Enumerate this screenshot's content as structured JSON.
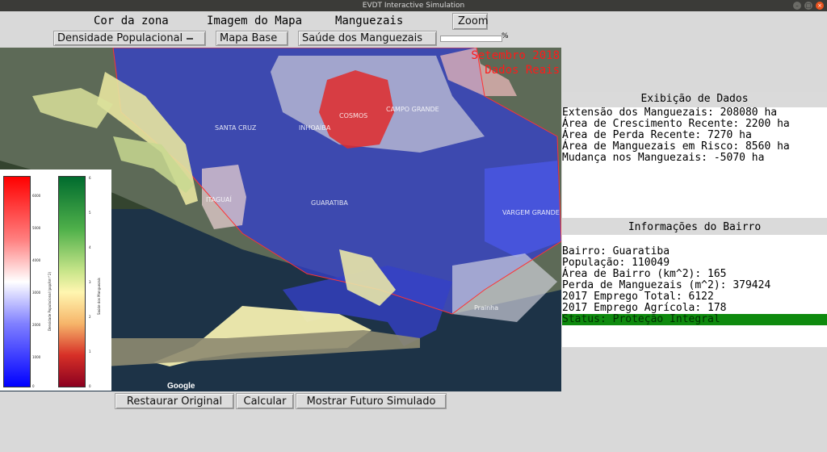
{
  "window": {
    "title": "EVDT Interactive Simulation"
  },
  "toolbar": {
    "zone_color_label": "Cor da zona",
    "map_image_label": "Imagem do Mapa",
    "mangroves_label": "Manguezais",
    "zoom_button": "Zoom",
    "zone_color_select": "Densidade Populacional",
    "map_image_select": "Mapa Base",
    "mangroves_select": "Saúde dos Manguezais",
    "slider_unit": "%"
  },
  "map": {
    "date_label": "Setembro 2018",
    "data_label": "Dados Reais",
    "google_logo": "Google",
    "places": [
      "SANTA CRUZ",
      "GUARATIBA",
      "CAMPO GRANDE",
      "COSMOS",
      "INHOAÍBA",
      "VARGEM GRANDE",
      "Prainha",
      "ITAGUAÍ"
    ]
  },
  "legend": {
    "left_label": "Densidade Populacional (pop/km^2)",
    "left_ticks": [
      "6000",
      "5000",
      "4000",
      "3000",
      "2000",
      "1000",
      "0"
    ],
    "right_label": "Saúde dos Manguezais",
    "right_ticks": [
      "6",
      "5",
      "4",
      "3",
      "2",
      "1",
      "0"
    ]
  },
  "data_panel": {
    "title": "Exibição de Dados",
    "lines": [
      "Extensão dos Manguezais: 208080 ha",
      "Área de Crescimento Recente: 2200 ha",
      "Área de Perda Recente: 7270 ha",
      "Área de Manguezais em Risco: 8560 ha",
      "Mudança nos Manguezais: -5070 ha"
    ]
  },
  "neighborhood_panel": {
    "title": "Informações do Bairro",
    "lines": [
      "Bairro:  Guaratiba",
      "População: 110049",
      "Área de Bairro (km^2): 165",
      "Perda de Manguezais (m^2): 379424",
      "2017 Emprego Total: 6122",
      "2017 Emprego Agrícola: 178"
    ],
    "status": "Status: Proteção Integral"
  },
  "actions": {
    "restore": "Restaurar Original",
    "calculate": "Calcular",
    "show_future": "Mostrar Futuro Simulado"
  },
  "colors": {
    "accent_red": "#ff1a1a",
    "status_green": "#0e8a0e"
  }
}
